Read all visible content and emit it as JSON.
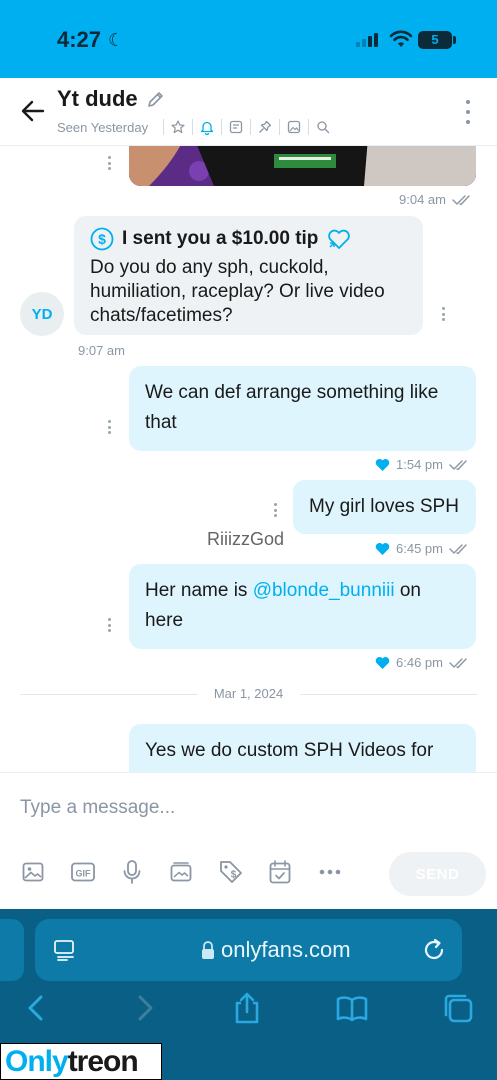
{
  "status_bar": {
    "time": "4:27",
    "battery": "5"
  },
  "header": {
    "title": "Yt dude",
    "seen": "Seen Yesterday"
  },
  "messages": {
    "image_time": "9:04 am",
    "tip_text": "I sent you a $10.00 tip",
    "tip_body": "Do you do any sph, cuckold, humiliation, raceplay? Or live video chats/facetimes?",
    "avatar_initials": "YD",
    "tip_time": "9:07 am",
    "m1_text": "We can def arrange something like that",
    "m1_time": "1:54 pm",
    "m2_text": "My girl loves SPH",
    "m2_time": "6:45 pm",
    "m3_prefix": "Her name is ",
    "m3_mention": "@blonde_bunniii",
    "m3_suffix": " on here",
    "m3_time": "6:46 pm",
    "date_divider": "Mar 1, 2024",
    "m4_text": "Yes we do custom SPH Videos for",
    "overlay_name": "RiiizzGod"
  },
  "composer": {
    "placeholder": "Type a message...",
    "send_label": "SEND"
  },
  "browser": {
    "url": "onlyfans.com"
  },
  "watermark": {
    "part1": "Only",
    "part2": "treon"
  },
  "colors": {
    "accent": "#00aff0",
    "outgoing_bubble": "#dff5fd",
    "incoming_bubble": "#eef2f4",
    "safari_bar": "#0a5f86"
  }
}
